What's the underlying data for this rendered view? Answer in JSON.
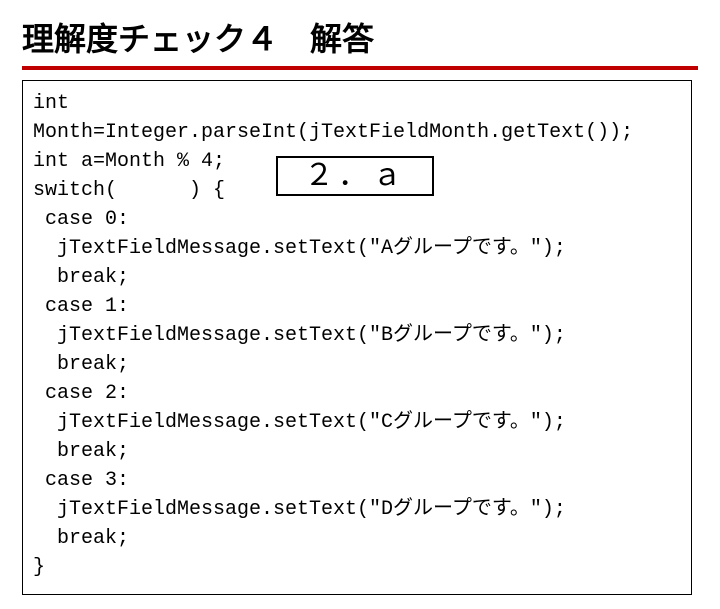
{
  "title": "理解度チェック４　解答",
  "code": {
    "l1": "int",
    "l2": "Month=Integer.parseInt(jTextFieldMonth.getText());",
    "l3": "int a=Month % 4;",
    "l4": "switch(      ) {",
    "l5": " case 0:",
    "l6": "  jTextFieldMessage.setText(\"Aグループです。\");",
    "l7": "  break;",
    "l8": " case 1:",
    "l9": "  jTextFieldMessage.setText(\"Bグループです。\");",
    "l10": "  break;",
    "l11": " case 2:",
    "l12": "  jTextFieldMessage.setText(\"Cグループです。\");",
    "l13": "  break;",
    "l14": " case 3:",
    "l15": "  jTextFieldMessage.setText(\"Dグループです。\");",
    "l16": "  break;",
    "l17": "}"
  },
  "answer": "２．ａ"
}
